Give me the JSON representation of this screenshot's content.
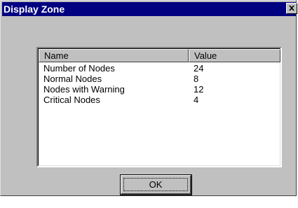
{
  "window": {
    "title": "Display Zone",
    "close_icon": "close-icon"
  },
  "list": {
    "columns": [
      "Name",
      "Value"
    ],
    "rows": [
      {
        "name": "Number of Nodes",
        "value": "24"
      },
      {
        "name": "Normal Nodes",
        "value": "8"
      },
      {
        "name": "Nodes with Warning",
        "value": "12"
      },
      {
        "name": "Critical Nodes",
        "value": "4"
      }
    ]
  },
  "buttons": {
    "ok_label": "OK"
  },
  "colors": {
    "titlebar": "#000080",
    "face": "#c0c0c0"
  }
}
